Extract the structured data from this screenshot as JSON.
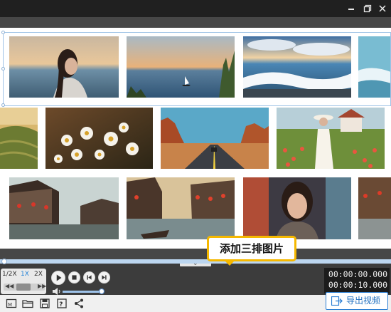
{
  "window": {
    "minimize_icon": "minimize-icon",
    "restore_icon": "restore-icon",
    "close_icon": "close-icon"
  },
  "canvas": {
    "rows": [
      {
        "photos": [
          "woman-by-sea",
          "sailboat-lake",
          "ocean-waves",
          "ocean-waves-partial"
        ]
      },
      {
        "photos": [
          "terraced-fields-partial",
          "daisy-field",
          "desert-road",
          "woman-in-flower-field"
        ]
      },
      {
        "photos": [
          "water-town-houses",
          "canal-boats",
          "woman-portrait",
          "water-town-partial"
        ]
      }
    ]
  },
  "tooltip": {
    "text": "添加三排图片"
  },
  "playback": {
    "speeds": [
      "1/2X",
      "1X",
      "2X"
    ],
    "selected_speed": "1X",
    "current_time": "00:00:00.000",
    "total_time": "00:00:10.000",
    "volume": 0.9
  },
  "toolbar": {
    "icons": [
      "project-settings-icon",
      "open-folder-icon",
      "save-icon",
      "save-as-icon",
      "share-icon"
    ],
    "export_label": "导出视频"
  },
  "colors": {
    "accent": "#2c7fd4",
    "tooltip_border": "#f5b800"
  }
}
